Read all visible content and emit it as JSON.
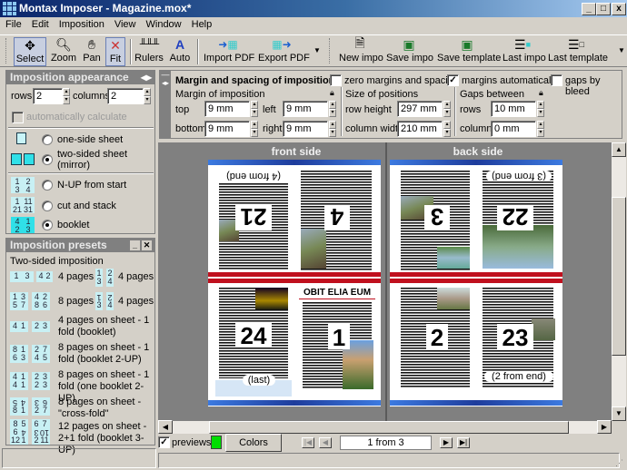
{
  "window": {
    "title": "Montax Imposer - Magazine.mox*",
    "minimize": "_",
    "maximize": "□",
    "close": "x"
  },
  "menu": [
    "File",
    "Edit",
    "Imposition",
    "View",
    "Window",
    "Help"
  ],
  "toolbar": {
    "tools": [
      {
        "label": "Select",
        "icon": "move-arrows-icon",
        "active": true
      },
      {
        "label": "Zoom",
        "icon": "magnifier-icon",
        "active": false
      },
      {
        "label": "Pan",
        "icon": "hand-icon",
        "active": false
      },
      {
        "label": "Fit",
        "icon": "fit-icon",
        "active": true
      },
      {
        "label": "Rulers",
        "icon": "ruler-icon",
        "active": false
      },
      {
        "label": "Auto",
        "icon": "auto-icon",
        "active": false
      },
      {
        "label": "Import PDF",
        "icon": "import-pdf-icon",
        "active": false
      },
      {
        "label": "Export PDF",
        "icon": "export-pdf-icon",
        "active": false
      }
    ],
    "file_actions": [
      {
        "label": "New impo",
        "icon": "new-document-icon"
      },
      {
        "label": "Save impo",
        "icon": "save-impo-icon"
      },
      {
        "label": "Save template",
        "icon": "save-template-icon"
      },
      {
        "label": "Last impo",
        "icon": "last-impo-icon"
      },
      {
        "label": "Last template",
        "icon": "last-template-icon"
      }
    ]
  },
  "appearance": {
    "title": "Imposition appearance",
    "rows_label": "rows",
    "rows": "2",
    "columns_label": "columns",
    "columns": "2",
    "auto_calc": "automatically calculate",
    "sheet_options": [
      {
        "label": "one-side sheet",
        "selected": false
      },
      {
        "label": "two-sided sheet (mirror)",
        "selected": true
      }
    ],
    "order_options": [
      {
        "label": "N-UP from start",
        "icon": [
          "1",
          "2",
          "3",
          "4"
        ],
        "selected": false
      },
      {
        "label": "cut and stack",
        "icon": [
          "1",
          "11",
          "21",
          "31"
        ],
        "selected": false
      },
      {
        "label": "booklet",
        "icon": [
          "4",
          "1",
          "2",
          "3"
        ],
        "selected": true
      }
    ]
  },
  "presets": {
    "title": "Imposition presets",
    "section": "Two-sided imposition",
    "items": [
      {
        "icon": "1 3 | 4 2",
        "label": "4 pages",
        "icon2": "1 2 / 3 4",
        "label2": "4 pages"
      },
      {
        "icon": "1 3 5 7 | 4 2 8 6",
        "label": "8 pages",
        "icon2": "1 2 / 3 4 (rotated)",
        "label2": "4 pages"
      },
      {
        "icon": "4 1 | 2 3",
        "label": "4 pages on sheet - 1 fold (booklet)"
      },
      {
        "icon": "8 1 6 3 | 2 7 4 5",
        "label": "8 pages on sheet - 1 fold (booklet 2-UP)"
      },
      {
        "icon": "4 1 4 1 | 2 3 2 3",
        "label": "8 pages on sheet - 1 fold (one booklet 2-UP)"
      },
      {
        "icon": "5 4 8 1 | 3 6 2 7",
        "label": "8 pages on sheet - \"cross-fold\""
      },
      {
        "icon": "8 5 6 4 12 1 | 6 7 3 10 2 11",
        "label": "12 pages on sheet - 2+1 fold (booklet 3-UP)"
      }
    ]
  },
  "margins": {
    "title": "Margin and spacing of imposition",
    "zero_margins": {
      "label": "zero margins and spacing",
      "checked": false
    },
    "auto_margins": {
      "label": "margins automatically",
      "checked": true
    },
    "gaps_bleed": {
      "label": "gaps by bleed",
      "checked": false
    },
    "margin_group": "Margin of imposition",
    "top_label": "top",
    "top": "9 mm",
    "left_label": "left",
    "left": "9 mm",
    "bottom_label": "bottom",
    "bottom": "9 mm",
    "right_label": "right",
    "right": "9 mm",
    "size_group": "Size of positions",
    "row_height_label": "row height",
    "row_height": "297 mm",
    "col_width_label": "column width",
    "col_width": "210 mm",
    "gaps_group": "Gaps between",
    "gap_rows_label": "rows",
    "gap_rows": "10 mm",
    "gap_cols_label": "columns",
    "gap_cols": "0 mm"
  },
  "preview": {
    "front_title": "front side",
    "back_title": "back side",
    "front_pages": [
      {
        "num": "21",
        "note": "(4 from end)",
        "rotated": true
      },
      {
        "num": "4",
        "note": "",
        "rotated": true
      },
      {
        "num": "24",
        "note": "(last)",
        "rotated": false
      },
      {
        "num": "1",
        "note": "",
        "rotated": false,
        "headline": "OBIT ELIA EUM"
      }
    ],
    "back_pages": [
      {
        "num": "3",
        "note": "",
        "rotated": true
      },
      {
        "num": "22",
        "note": "(3 from end)",
        "rotated": true
      },
      {
        "num": "2",
        "note": "",
        "rotated": false
      },
      {
        "num": "23",
        "note": "(2 from end)",
        "rotated": false
      }
    ]
  },
  "bottom": {
    "previews_label": "previews",
    "previews_checked": true,
    "color_swatch": "#00dd00",
    "colors_button": "Colors",
    "page_indicator": "1 from 3"
  }
}
